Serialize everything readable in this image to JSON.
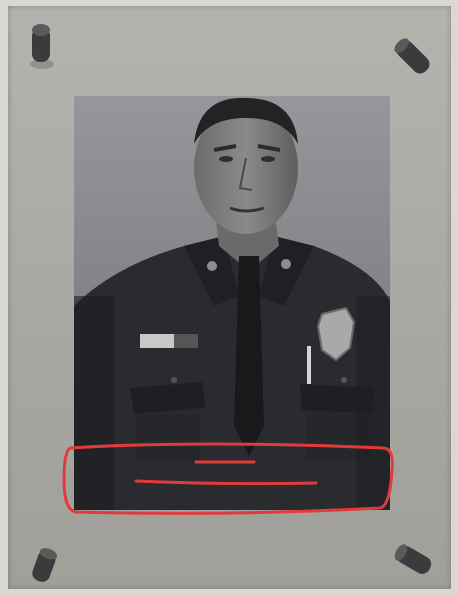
{
  "scene": {
    "board_color": "#aaa8a3",
    "photo_background": "#8c8d8f",
    "uniform_color": "#2a2b2e",
    "annotation_color": "#e03b3b"
  },
  "pins": [
    {
      "name": "pin-top-left"
    },
    {
      "name": "pin-top-right"
    },
    {
      "name": "pin-bottom-left"
    },
    {
      "name": "pin-bottom-right"
    }
  ],
  "photo": {
    "subject": "officer-portrait",
    "name_tag_text": ""
  }
}
